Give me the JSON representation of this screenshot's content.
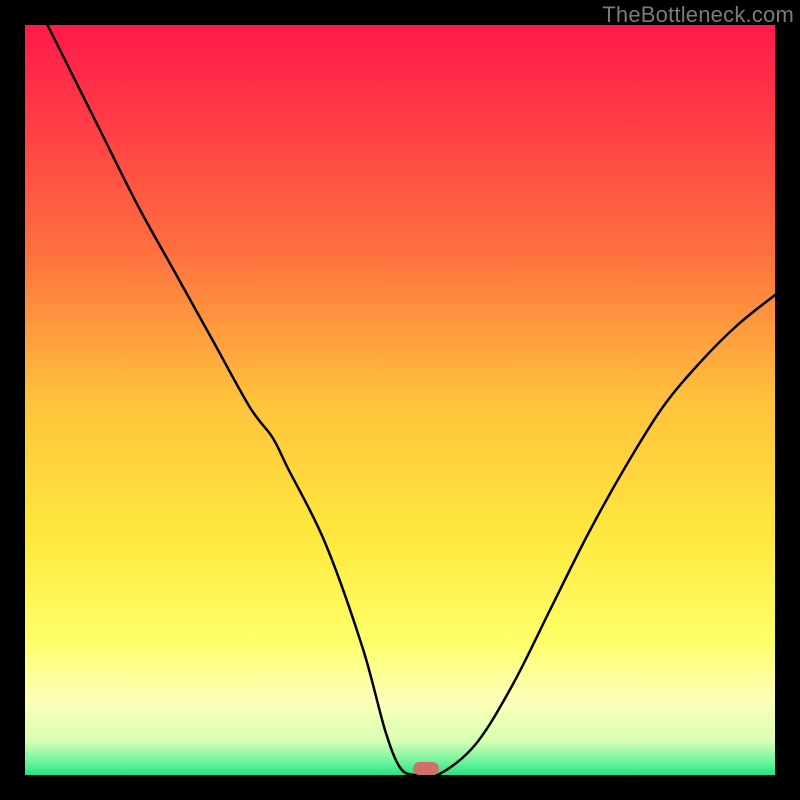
{
  "watermark": "TheBottleneck.com",
  "colors": {
    "frame": "#000000",
    "curve": "#000000",
    "marker": "#cf7169",
    "gradient_stops": [
      {
        "offset": 0.0,
        "color": "#ff1a4b"
      },
      {
        "offset": 0.12,
        "color": "#ff3a47"
      },
      {
        "offset": 0.3,
        "color": "#ff6f3f"
      },
      {
        "offset": 0.5,
        "color": "#ffc23c"
      },
      {
        "offset": 0.68,
        "color": "#ffe83e"
      },
      {
        "offset": 0.82,
        "color": "#feff68"
      },
      {
        "offset": 0.9,
        "color": "#fcffb8"
      },
      {
        "offset": 0.955,
        "color": "#d8ffb4"
      },
      {
        "offset": 0.985,
        "color": "#63f39a"
      },
      {
        "offset": 1.0,
        "color": "#28e07e"
      }
    ]
  },
  "chart_data": {
    "type": "line",
    "title": "",
    "xlabel": "",
    "ylabel": "",
    "xlim": [
      0,
      100
    ],
    "ylim": [
      0,
      100
    ],
    "grid": false,
    "legend": false,
    "series": [
      {
        "name": "bottleneck-curve",
        "x": [
          3,
          5,
          10,
          15,
          20,
          25,
          30,
          33,
          35,
          40,
          45,
          48,
          50,
          52,
          55,
          60,
          65,
          70,
          75,
          80,
          85,
          90,
          95,
          100
        ],
        "y": [
          100,
          96,
          86,
          76,
          67,
          58,
          49,
          45,
          41,
          31,
          17,
          6,
          1,
          0,
          0,
          4,
          12,
          22,
          32,
          41,
          49,
          55,
          60,
          64
        ]
      }
    ],
    "marker": {
      "x": 53.5,
      "y": 0,
      "w": 3.5,
      "h": 1.8
    }
  }
}
